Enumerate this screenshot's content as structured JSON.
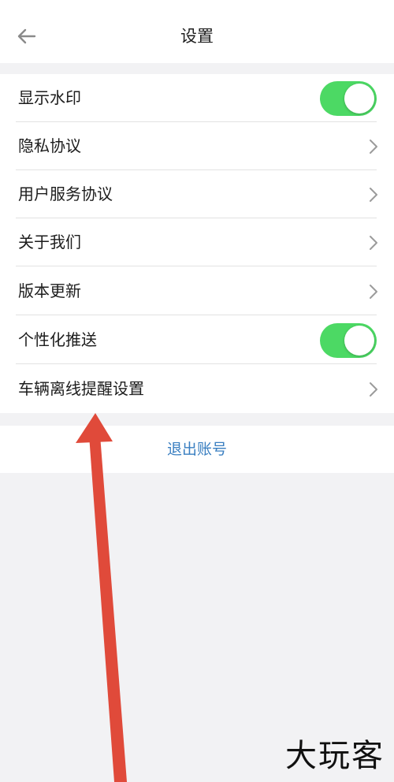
{
  "header": {
    "title": "设置",
    "back_icon": "arrow-left-icon"
  },
  "settings": [
    {
      "label": "显示水印",
      "control": "toggle",
      "on": true
    },
    {
      "label": "隐私协议",
      "control": "chevron"
    },
    {
      "label": "用户服务协议",
      "control": "chevron"
    },
    {
      "label": "关于我们",
      "control": "chevron"
    },
    {
      "label": "版本更新",
      "control": "chevron"
    },
    {
      "label": "个性化推送",
      "control": "toggle",
      "on": true
    },
    {
      "label": "车辆离线提醒设置",
      "control": "chevron"
    }
  ],
  "logout": {
    "label": "退出账号"
  },
  "watermark": {
    "text": "大玩客"
  },
  "colors": {
    "toggle_on": "#4cd964",
    "logout_text": "#3a7fc1",
    "arrow": "#e04a3a",
    "background": "#f2f2f4"
  }
}
